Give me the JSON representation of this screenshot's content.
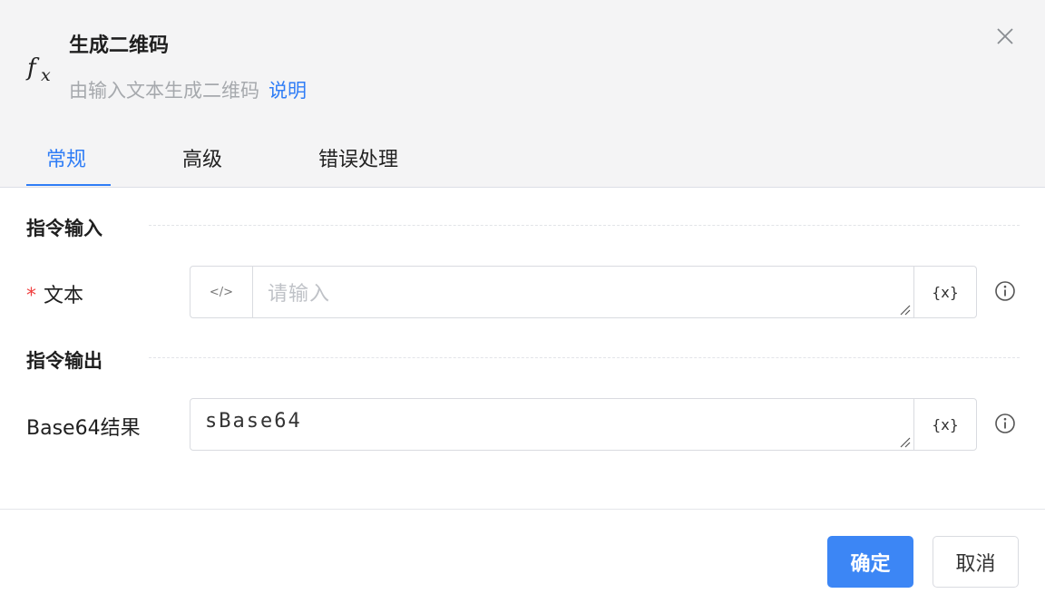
{
  "header": {
    "icon": "fx-icon",
    "icon_f": "f",
    "icon_x": "x",
    "title": "生成二维码",
    "subtitle": "由输入文本生成二维码",
    "help_link": "说明"
  },
  "tabs": [
    {
      "label": "常规",
      "active": true
    },
    {
      "label": "高级",
      "active": false
    },
    {
      "label": "错误处理",
      "active": false
    }
  ],
  "sections": {
    "input_title": "指令输入",
    "output_title": "指令输出"
  },
  "fields": {
    "text": {
      "required_mark": "*",
      "label": "文本",
      "placeholder": "请输入",
      "code_icon": "</>",
      "var_icon": "{x}"
    },
    "base64": {
      "label": "Base64结果",
      "value": "sBase64",
      "var_icon": "{x}"
    }
  },
  "footer": {
    "confirm": "确定",
    "cancel": "取消"
  },
  "colors": {
    "accent": "#2f7df6",
    "primary_button": "#3c86f5",
    "required": "#f04040",
    "header_bg": "#f4f4f5"
  }
}
